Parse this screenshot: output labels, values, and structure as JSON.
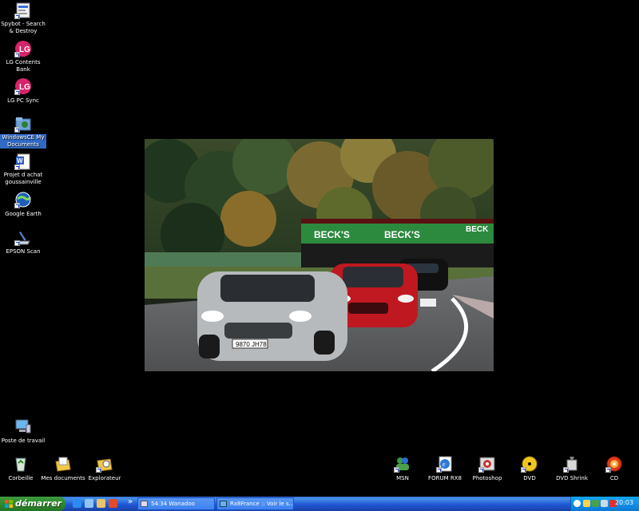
{
  "desktop_left": [
    {
      "label": "Spybot - Search & Destroy",
      "icon": "spybot-icon"
    },
    {
      "label": "LG Contents Bank",
      "icon": "lg-contents-bank-icon"
    },
    {
      "label": "LG PC Sync",
      "icon": "lg-pc-sync-icon"
    },
    {
      "label": "WindowsCE My Documents",
      "icon": "folder-icon",
      "selected": true
    },
    {
      "label": "Projet d achat goussainville",
      "icon": "word-document-icon"
    },
    {
      "label": "Google Earth",
      "icon": "google-earth-icon"
    },
    {
      "label": "EPSON Scan",
      "icon": "scanner-icon"
    },
    {
      "label": "Poste de travail",
      "icon": "computer-icon"
    }
  ],
  "desktop_bottom": [
    {
      "label": "Corbeille",
      "icon": "recycle-bin-icon"
    },
    {
      "label": "Mes documents",
      "icon": "my-documents-icon"
    },
    {
      "label": "Explorateur",
      "icon": "explorer-icon"
    }
  ],
  "desktop_bottom_right": [
    {
      "label": "MSN",
      "icon": "msn-icon"
    },
    {
      "label": "FORUM RX8",
      "icon": "forum-shortcut-icon"
    },
    {
      "label": "Photoshop",
      "icon": "photoshop-icon"
    },
    {
      "label": "DVD",
      "icon": "dvd-icon"
    },
    {
      "label": "DVD Shrink",
      "icon": "dvd-shrink-icon"
    },
    {
      "label": "CD",
      "icon": "cd-burn-icon"
    }
  ],
  "wallpaper": {
    "banner_text_left": "BECK'S",
    "banner_text_mid": "BECK'S",
    "banner_text_right": "BECK",
    "license_plate": "9870 JH78"
  },
  "taskbar": {
    "start_label": "démarrer",
    "overflow_label": "»",
    "tasks": [
      {
        "label": "54:34 Wanadoo",
        "icon": "window-icon"
      },
      {
        "label": "Rx8France :: Voir le s...",
        "icon": "browser-window-icon"
      }
    ],
    "clock": "20:03"
  },
  "colors": {
    "taskbar_blue": "#245edb",
    "start_green": "#2e8b2e",
    "tray_blue": "#0f95e8",
    "selection_blue": "#316ac5"
  }
}
